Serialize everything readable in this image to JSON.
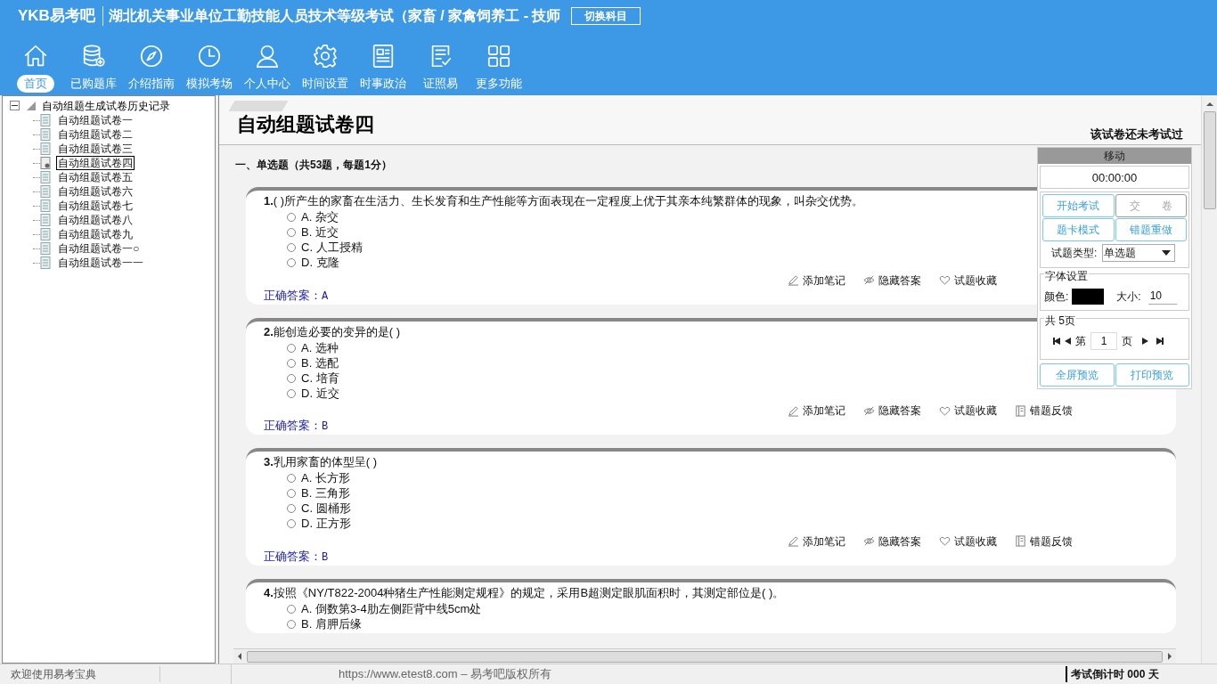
{
  "header": {
    "logo": "YKB易考吧",
    "title": "湖北机关事业单位工勤技能人员技术等级考试（家畜 / 家禽饲养工 - 技师",
    "switch_button": "切换科目"
  },
  "nav": [
    {
      "label": "首页",
      "selected": true
    },
    {
      "label": "已购题库",
      "selected": false
    },
    {
      "label": "介绍指南",
      "selected": false
    },
    {
      "label": "模拟考场",
      "selected": false
    },
    {
      "label": "个人中心",
      "selected": false
    },
    {
      "label": "时间设置",
      "selected": false
    },
    {
      "label": "时事政治",
      "selected": false
    },
    {
      "label": "证照易",
      "selected": false
    },
    {
      "label": "更多功能",
      "selected": false
    }
  ],
  "tree": {
    "label": "自动组题生成试卷历史记录",
    "expanded": true,
    "children": [
      {
        "label": "自动组题试卷一",
        "selected": false
      },
      {
        "label": "自动组题试卷二",
        "selected": false
      },
      {
        "label": "自动组题试卷三",
        "selected": false
      },
      {
        "label": "自动组题试卷四",
        "selected": true
      },
      {
        "label": "自动组题试卷五",
        "selected": false
      },
      {
        "label": "自动组题试卷六",
        "selected": false
      },
      {
        "label": "自动组题试卷七",
        "selected": false
      },
      {
        "label": "自动组题试卷八",
        "selected": false
      },
      {
        "label": "自动组题试卷九",
        "selected": false
      },
      {
        "label": "自动组题试卷一○",
        "selected": false
      },
      {
        "label": "自动组题试卷一一",
        "selected": false
      }
    ]
  },
  "paper": {
    "title": "自动组题试卷四",
    "status": "该试卷还未考试过",
    "section": "一、单选题（共53题，每题1分）",
    "questions": [
      {
        "number": "1.",
        "text": "( )所产生的家畜在生活力、生长发育和生产性能等方面表现在一定程度上优于其亲本纯繁群体的现象，叫杂交优势。",
        "options": [
          {
            "label": "A. 杂交",
            "checked": false
          },
          {
            "label": "B. 近交",
            "checked": false
          },
          {
            "label": "C. 人工授精",
            "checked": false
          },
          {
            "label": "D. 克隆",
            "checked": false
          }
        ],
        "actions": [
          "添加笔记",
          "隐藏答案",
          "试题收藏"
        ],
        "answer_label": "正确答案：",
        "answer": "A"
      },
      {
        "number": "2.",
        "text": "能创造必要的变异的是( )",
        "options": [
          {
            "label": "A. 选种",
            "checked": false
          },
          {
            "label": "B. 选配",
            "checked": false
          },
          {
            "label": "C. 培育",
            "checked": false
          },
          {
            "label": "D. 近交",
            "checked": false
          }
        ],
        "actions": [
          "添加笔记",
          "隐藏答案",
          "试题收藏",
          "错题反馈"
        ],
        "answer_label": "正确答案：",
        "answer": "B"
      },
      {
        "number": "3.",
        "text": "乳用家畜的体型呈( )",
        "options": [
          {
            "label": "A. 长方形",
            "checked": false
          },
          {
            "label": "B. 三角形",
            "checked": false
          },
          {
            "label": "C. 圆桶形",
            "checked": false
          },
          {
            "label": "D. 正方形",
            "checked": false
          }
        ],
        "actions": [
          "添加笔记",
          "隐藏答案",
          "试题收藏",
          "错题反馈"
        ],
        "answer_label": "正确答案：",
        "answer": "B"
      },
      {
        "number": "4.",
        "text": "按照《NY/T822-2004种猪生产性能测定规程》的规定，采用B超测定眼肌面积时，其测定部位是( )。",
        "options": [
          {
            "label": "A. 倒数第3-4肋左侧距背中线5cm处",
            "checked": false
          },
          {
            "label": "B. 肩胛后缘",
            "checked": false
          }
        ]
      }
    ]
  },
  "panel": {
    "move": "移动",
    "timer": "00:00:00",
    "buttons": [
      {
        "label": "开始考试",
        "disabled": false
      },
      {
        "label": "交　　卷",
        "disabled": true
      },
      {
        "label": "题卡模式",
        "disabled": false
      },
      {
        "label": "错题重做",
        "disabled": false
      }
    ],
    "type_label": "试题类型:",
    "type_value": "单选题",
    "font_group": "字体设置",
    "color_label": "颜色:",
    "size_label": "大小:",
    "size_value": "10",
    "pages_group": "共 5页",
    "page_prefix": "第",
    "page_value": "1",
    "page_suffix": "页",
    "bottom_buttons": [
      "全屏预览",
      "打印预览"
    ]
  },
  "status_bar": {
    "welcome": "欢迎使用易考宝典",
    "copyright": "https://www.etest8.com – 易考吧版权所有",
    "countdown": "考试倒计时 000 天"
  }
}
